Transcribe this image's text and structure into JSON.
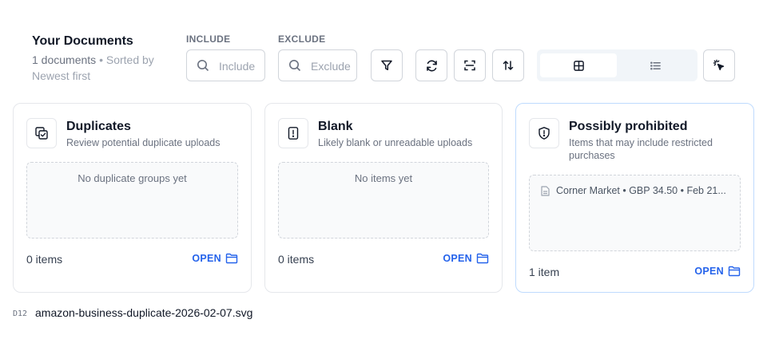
{
  "header": {
    "title": "Your Documents",
    "count": "1 documents",
    "sort": "• Sorted by Newest first"
  },
  "filters": {
    "include_label": "INCLUDE",
    "include_placeholder": "Include",
    "exclude_label": "EXCLUDE",
    "exclude_placeholder": "Exclude"
  },
  "toolbar_icons": [
    "filter-icon",
    "refresh-icon",
    "scan-icon",
    "sort-icon"
  ],
  "view_toggle": {
    "options": [
      "grid-view-icon",
      "list-view-icon"
    ],
    "active": "grid"
  },
  "cards": [
    {
      "title": "Duplicates",
      "description": "Review potential duplicate uploads",
      "icon": "duplicate-check-icon",
      "empty_text": "No duplicate groups yet",
      "count": "0 items",
      "open_label": "OPEN"
    },
    {
      "title": "Blank",
      "description": "Likely blank or unreadable uploads",
      "icon": "alert-document-icon",
      "empty_text": "No items yet",
      "count": "0 items",
      "open_label": "OPEN"
    },
    {
      "title": "Possibly prohibited",
      "description": "Items that may include restricted purchases",
      "icon": "shield-alert-icon",
      "items": [
        "Corner Market • GBP 34.50 • Feb 21..."
      ],
      "count": "1 item",
      "open_label": "OPEN"
    }
  ],
  "footer": {
    "tag": "D12",
    "filename": "amazon-business-duplicate-2026-02-07.svg"
  },
  "colors": {
    "accent": "#2563eb",
    "highlight_border": "#bfdbfe",
    "muted": "#9ca3af"
  }
}
